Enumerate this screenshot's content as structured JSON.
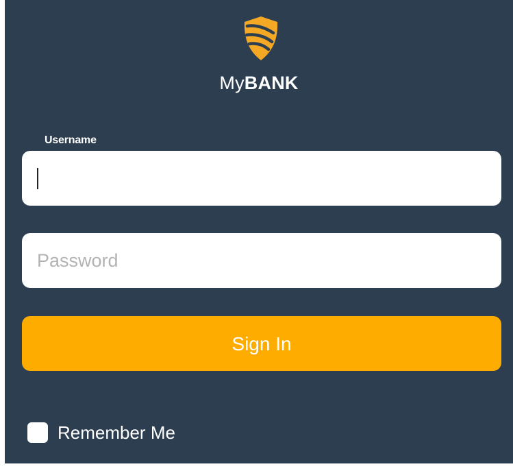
{
  "brand": {
    "name_light": "My",
    "name_bold": "BANK",
    "logo_icon": "shield-icon",
    "logo_color": "#f5a823"
  },
  "form": {
    "username_label": "Username",
    "username_value": "",
    "password_placeholder": "Password",
    "password_value": "",
    "signin_label": "Sign In",
    "remember_label": "Remember Me",
    "remember_checked": false
  },
  "colors": {
    "panel_bg": "#2d3e50",
    "button_bg": "#ffac00",
    "field_bg": "#ffffff"
  }
}
